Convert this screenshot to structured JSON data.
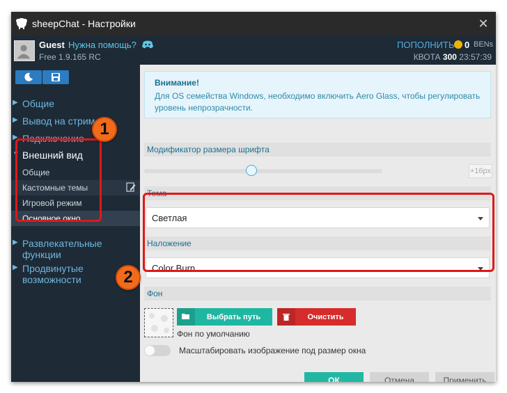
{
  "window": {
    "title": "sheepChat - Настройки"
  },
  "user": {
    "name": "Guest",
    "help_link": "Нужна помощь?",
    "version": "Free 1.9.165 RC",
    "topup_label": "ПОПОЛНИТЬ",
    "coins": "0",
    "currency": "BENs",
    "quota_label": "КВОТА",
    "quota_value": "300",
    "time": "23:57:39"
  },
  "sidebar": {
    "items": [
      {
        "label": "Общие"
      },
      {
        "label": "Вывод на стрим"
      },
      {
        "label": "Подключение"
      },
      {
        "label": "Внешний вид"
      },
      {
        "label": "Развлекательные функции"
      },
      {
        "label": "Продвинутые возможности"
      }
    ],
    "sub_items": [
      {
        "label": "Общие"
      },
      {
        "label": "Кастомные темы"
      },
      {
        "label": "Игровой режим"
      },
      {
        "label": "Основное окно"
      }
    ]
  },
  "badges": {
    "first": "1",
    "second": "2"
  },
  "notice": {
    "title": "Внимание!",
    "body": "Для OS семейства Windows, необходимо включить Aero Glass, чтобы регулировать уровень непрозрачности."
  },
  "font_size": {
    "label": "Модификатор размера шрифта",
    "value_label": "+16px",
    "slider_fraction": 0.45
  },
  "theme": {
    "label": "Тема",
    "value": "Светлая"
  },
  "blend": {
    "label": "Наложение",
    "value": "Color Burn"
  },
  "background": {
    "label": "Фон",
    "choose_button": "Выбрать путь",
    "clear_button": "Очистить",
    "default_caption": "Фон по умолчанию",
    "scale_label": "Масштабировать изображение под размер окна",
    "scale_enabled": false
  },
  "footer": {
    "ok": "ОК",
    "cancel": "Отмена",
    "apply": "Применить"
  },
  "colors": {
    "accent": "#20b7a2",
    "danger": "#d62c2c",
    "highlight": "#e01818",
    "badge": "#f26b1d"
  }
}
